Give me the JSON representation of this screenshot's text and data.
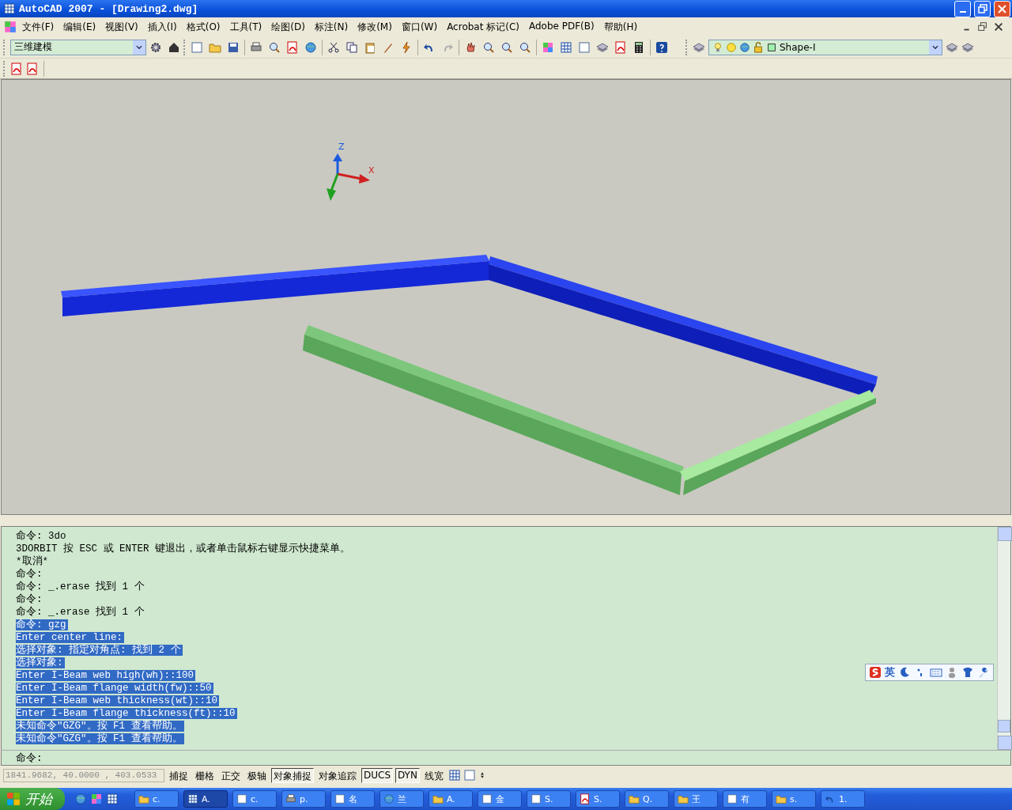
{
  "window": {
    "title": "AutoCAD 2007 - [Drawing2.dwg]"
  },
  "menu": [
    "文件(F)",
    "编辑(E)",
    "视图(V)",
    "插入(I)",
    "格式(O)",
    "工具(T)",
    "绘图(D)",
    "标注(N)",
    "修改(M)",
    "窗口(W)",
    "Acrobat 标记(C)",
    "Adobe PDF(B)",
    "帮助(H)"
  ],
  "toolbar": {
    "workspace": {
      "value": "三维建模"
    },
    "layer": {
      "value": "Shape-I"
    }
  },
  "viewport": {
    "axis_labels": [
      "Z",
      "X"
    ]
  },
  "command": {
    "lines": [
      {
        "text": "命令: 3do",
        "selected": false
      },
      {
        "text": "3DORBIT 按 ESC 或 ENTER 键退出，或者单击鼠标右键显示快捷菜单。",
        "selected": false
      },
      {
        "text": "*取消*",
        "selected": false
      },
      {
        "text": "命令:",
        "selected": false
      },
      {
        "text": "命令: _.erase 找到 1 个",
        "selected": false
      },
      {
        "text": "命令:",
        "selected": false
      },
      {
        "text": "命令: _.erase 找到 1 个",
        "selected": false
      },
      {
        "text": "命令: gzg",
        "selected": true
      },
      {
        "text": "Enter center line:",
        "selected": true
      },
      {
        "text": "选择对象: 指定对角点: 找到 2 个",
        "selected": true
      },
      {
        "text": "选择对象:",
        "selected": true
      },
      {
        "text": "Enter I-Beam web high(wh)::100",
        "selected": true
      },
      {
        "text": "Enter I-Beam flange width(fw)::50",
        "selected": true
      },
      {
        "text": "Enter I-Beam web thickness(wt)::10",
        "selected": true
      },
      {
        "text": "Enter I-Beam flange thickness(ft)::10",
        "selected": true
      },
      {
        "text": "未知命令\"GZG\"。按 F1 查看帮助。",
        "selected": true
      },
      {
        "text": "未知命令\"GZG\"。按 F1 查看帮助。",
        "selected": true
      }
    ],
    "prompt": "命令:"
  },
  "ime": {
    "mode": "英"
  },
  "status": {
    "coordinates": "1841.9682, 40.0000 , 403.0533",
    "toggles": [
      {
        "label": "捕捉",
        "on": false
      },
      {
        "label": "栅格",
        "on": false
      },
      {
        "label": "正交",
        "on": false
      },
      {
        "label": "极轴",
        "on": false
      },
      {
        "label": "对象捕捉",
        "on": true
      },
      {
        "label": "对象追踪",
        "on": false
      },
      {
        "label": "DUCS",
        "on": true
      },
      {
        "label": "DYN",
        "on": true
      },
      {
        "label": "线宽",
        "on": false
      }
    ]
  },
  "taskbar": {
    "start": "开始",
    "tasks": [
      {
        "label": "c.",
        "selected": false
      },
      {
        "label": "A.",
        "selected": true
      },
      {
        "label": "c.",
        "selected": false
      },
      {
        "label": "p.",
        "selected": false
      },
      {
        "label": "名",
        "selected": false
      },
      {
        "label": "兰",
        "selected": false
      },
      {
        "label": "A.",
        "selected": false
      },
      {
        "label": "金",
        "selected": false
      },
      {
        "label": "S.",
        "selected": false
      },
      {
        "label": "S.",
        "selected": false
      },
      {
        "label": "Q.",
        "selected": false
      },
      {
        "label": "王",
        "selected": false
      },
      {
        "label": "有",
        "selected": false
      },
      {
        "label": "s.",
        "selected": false
      },
      {
        "label": "1.",
        "selected": false
      }
    ]
  }
}
